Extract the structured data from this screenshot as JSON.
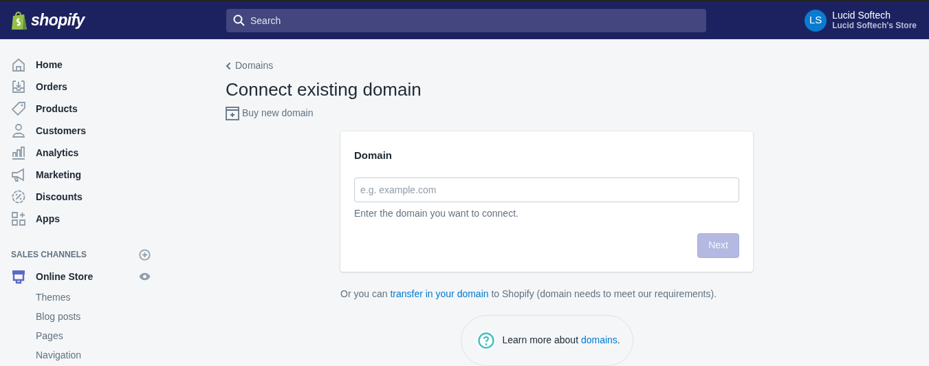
{
  "topbar": {
    "logo": "shopify",
    "search": {
      "placeholder": "Search"
    },
    "user": {
      "initials": "LS",
      "name": "Lucid Softech",
      "store": "Lucid Softech's Store"
    }
  },
  "sidebar": {
    "items": [
      {
        "label": "Home",
        "selected": false
      },
      {
        "label": "Orders",
        "selected": false
      },
      {
        "label": "Products",
        "selected": false
      },
      {
        "label": "Customers",
        "selected": false
      },
      {
        "label": "Analytics",
        "selected": false
      },
      {
        "label": "Marketing",
        "selected": false
      },
      {
        "label": "Discounts",
        "selected": false
      },
      {
        "label": "Apps",
        "selected": false
      }
    ],
    "sales_channels": {
      "heading": "SALES CHANNELS",
      "channel": {
        "label": "Online Store",
        "selected": true,
        "children": [
          {
            "label": "Themes"
          },
          {
            "label": "Blog posts"
          },
          {
            "label": "Pages"
          },
          {
            "label": "Navigation"
          }
        ]
      }
    }
  },
  "page": {
    "breadcrumb": "Domains",
    "title": "Connect existing domain",
    "action": "Buy new domain",
    "card": {
      "title": "Domain",
      "field": {
        "placeholder": "e.g. example.com"
      },
      "help": "Enter the domain you want to connect.",
      "button": {
        "label": "Next",
        "disabled": true
      }
    },
    "transfer": {
      "before": "Or you can ",
      "link": "transfer in your domain",
      "after": " to Shopify (domain needs to meet our requirements)."
    },
    "learn_more": {
      "before": "Learn more about ",
      "link": "domains",
      "after": "."
    }
  }
}
